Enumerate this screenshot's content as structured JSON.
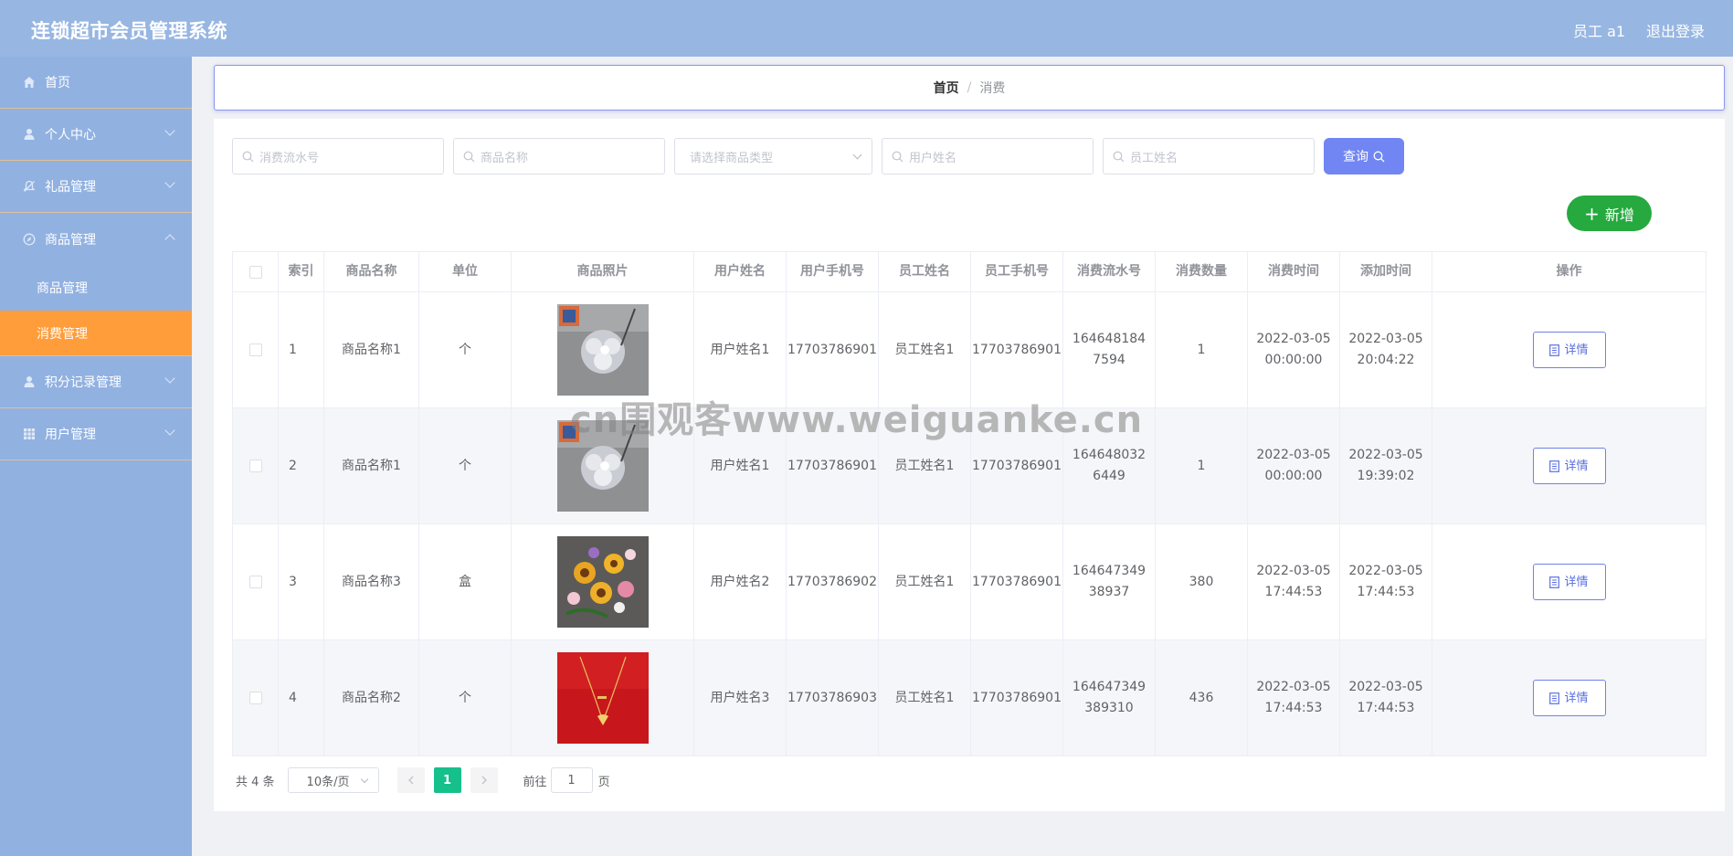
{
  "header": {
    "title": "连锁超市会员管理系统",
    "user": "员工 a1",
    "logout": "退出登录"
  },
  "sidebar": {
    "items": [
      {
        "label": "首页",
        "icon": "home-icon"
      },
      {
        "label": "个人中心",
        "icon": "user-icon"
      },
      {
        "label": "礼品管理",
        "icon": "bell-off-icon"
      },
      {
        "label": "商品管理",
        "icon": "compass-icon",
        "expanded": true,
        "children": [
          {
            "label": "商品管理"
          },
          {
            "label": "消费管理",
            "active": true
          }
        ]
      },
      {
        "label": "积分记录管理",
        "icon": "user-icon"
      },
      {
        "label": "用户管理",
        "icon": "grid-icon"
      }
    ]
  },
  "breadcrumb": {
    "home": "首页",
    "separator": "/",
    "current": "消费"
  },
  "search": {
    "serial_placeholder": "消费流水号",
    "goods_name_placeholder": "商品名称",
    "goods_type_placeholder": "请选择商品类型",
    "user_name_placeholder": "用户姓名",
    "staff_name_placeholder": "员工姓名",
    "query_label": "查询"
  },
  "toolbar": {
    "add_label": "新增"
  },
  "table": {
    "headers": [
      "索引",
      "商品名称",
      "单位",
      "商品照片",
      "用户姓名",
      "用户手机号",
      "员工姓名",
      "员工手机号",
      "消费流水号",
      "消费数量",
      "消费时间",
      "添加时间",
      "操作"
    ],
    "rows": [
      {
        "index": "1",
        "goods_name": "商品名称1",
        "unit": "个",
        "photo": "jewelry-brooch-photo",
        "user_name": "用户姓名1",
        "user_phone": "17703786901",
        "staff_name": "员工姓名1",
        "staff_phone": "17703786901",
        "serial": "1646481847594",
        "quantity": "1",
        "consume_time": "2022-03-05 00:00:00",
        "add_time": "2022-03-05 20:04:22",
        "action": "详情"
      },
      {
        "index": "2",
        "goods_name": "商品名称1",
        "unit": "个",
        "photo": "jewelry-brooch-photo",
        "user_name": "用户姓名1",
        "user_phone": "17703786901",
        "staff_name": "员工姓名1",
        "staff_phone": "17703786901",
        "serial": "1646480326449",
        "quantity": "1",
        "consume_time": "2022-03-05 00:00:00",
        "add_time": "2022-03-05 19:39:02",
        "action": "详情"
      },
      {
        "index": "3",
        "goods_name": "商品名称3",
        "unit": "盒",
        "photo": "flower-bouquet-photo",
        "user_name": "用户姓名2",
        "user_phone": "17703786902",
        "staff_name": "员工姓名1",
        "staff_phone": "17703786901",
        "serial": "16464734938937",
        "quantity": "380",
        "consume_time": "2022-03-05 17:44:53",
        "add_time": "2022-03-05 17:44:53",
        "action": "详情"
      },
      {
        "index": "4",
        "goods_name": "商品名称2",
        "unit": "个",
        "photo": "gold-necklace-photo",
        "user_name": "用户姓名3",
        "user_phone": "17703786903",
        "staff_name": "员工姓名1",
        "staff_phone": "17703786901",
        "serial": "164647349389310",
        "quantity": "436",
        "consume_time": "2022-03-05 17:44:53",
        "add_time": "2022-03-05 17:44:53",
        "action": "详情"
      }
    ]
  },
  "pagination": {
    "total": "共 4 条",
    "page_size": "10条/页",
    "current_page": "1",
    "goto_label": "前往",
    "goto_value": "1",
    "page_suffix": "页"
  },
  "watermark": "cn围观客www.weiguanke.cn",
  "colors": {
    "header_bg": "#97b6e2",
    "sidebar_bg": "#91b1e1",
    "active_menu": "#ff9d3b",
    "query_button": "#7186f3",
    "add_button": "#26a93f",
    "current_page": "#16c08b"
  }
}
